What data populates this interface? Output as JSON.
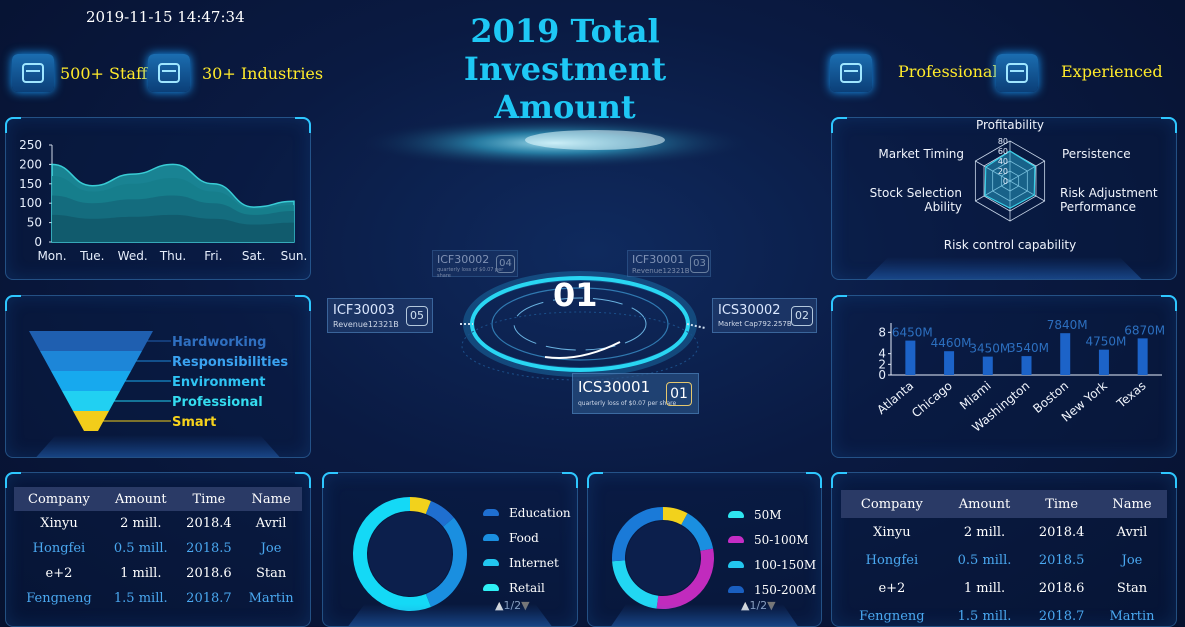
{
  "header": {
    "datetime": "2019-11-15 14:47:34",
    "title_line1": "2019 Total Investment",
    "title_line2": "Amount",
    "left_items": [
      {
        "label": "500+ Staff",
        "icon": "server-icon"
      },
      {
        "label": "30+ Industries",
        "icon": "server-icon"
      }
    ],
    "right_items": [
      {
        "label": "Professional",
        "icon": "server-icon"
      },
      {
        "label": "Experienced",
        "icon": "server-icon"
      }
    ]
  },
  "area_chart": {
    "type": "area",
    "x": [
      "Mon.",
      "Tue.",
      "Wed.",
      "Thu.",
      "Fri.",
      "Sat.",
      "Sun."
    ],
    "series": [
      {
        "values": [
          200,
          145,
          175,
          200,
          150,
          90,
          105
        ]
      },
      {
        "values": [
          170,
          130,
          150,
          165,
          130,
          85,
          95
        ]
      },
      {
        "values": [
          120,
          100,
          110,
          120,
          100,
          70,
          80
        ]
      },
      {
        "values": [
          70,
          60,
          65,
          70,
          60,
          45,
          50
        ]
      }
    ],
    "yticks": [
      "250",
      "200",
      "150",
      "100",
      "50",
      "0"
    ],
    "ylim": [
      0,
      250
    ]
  },
  "funnel": {
    "levels": [
      {
        "label": "Hardworking",
        "color": "#1f5fb0",
        "text_color": "#2f6fc0"
      },
      {
        "label": "Responsibilities",
        "color": "#1d86d8",
        "text_color": "#3aa2f0"
      },
      {
        "label": "Environment",
        "color": "#17a9ee",
        "text_color": "#2fc4f4"
      },
      {
        "label": "Professional",
        "color": "#21d0f2",
        "text_color": "#34dcef"
      },
      {
        "label": "Smart",
        "color": "#f2cd1a",
        "text_color": "#f6d21c"
      }
    ]
  },
  "center": {
    "big_number": "01",
    "chips": [
      {
        "title": "ICF30002",
        "sub": "quarterly loss of $0.07 per share",
        "num": "04"
      },
      {
        "title": "ICF30001",
        "sub": "Revenue12321B",
        "num": "03"
      },
      {
        "title": "ICF30003",
        "sub": "Revenue12321B",
        "num": "05"
      },
      {
        "title": "ICS30002",
        "sub": "Market Cap792.257B",
        "num": "02"
      },
      {
        "title": "ICS30001",
        "sub": "quarterly loss of $0.07 per share",
        "num": "01"
      }
    ]
  },
  "radar": {
    "indicators": [
      "Profitability",
      "Persistence",
      "Risk Adjustment\nPerformance",
      "Risk control capability",
      "Stock Selection\nAbility",
      "Market Timing"
    ],
    "scale": [
      "80",
      "60",
      "40",
      "20",
      "0"
    ],
    "values": [
      75,
      72,
      70,
      68,
      72,
      70
    ]
  },
  "bar_chart": {
    "type": "bar",
    "categories": [
      "Atlanta",
      "Chicago",
      "Miami",
      "Washington",
      "Boston",
      "New York",
      "Texas"
    ],
    "values": [
      6.45,
      4.46,
      3.45,
      3.54,
      7.84,
      4.75,
      6.87
    ],
    "data_labels": [
      "6450M",
      "4460M",
      "3450M",
      "3540M",
      "7840M",
      "4750M",
      "6870M"
    ],
    "yticks": [
      "8",
      "4",
      "2",
      "0"
    ],
    "ylim": [
      0,
      9
    ]
  },
  "table_left": {
    "headers": [
      "Company",
      "Amount",
      "Time",
      "Name"
    ],
    "rows": [
      [
        "Xinyu",
        "2 mill.",
        "2018.4",
        "Avril"
      ],
      [
        "Hongfei",
        "0.5 mill.",
        "2018.5",
        "Joe"
      ],
      [
        "e+2",
        "1 mill.",
        "2018.6",
        "Stan"
      ],
      [
        "Fengneng",
        "1.5 mill.",
        "2018.7",
        "Martin"
      ]
    ]
  },
  "table_right": {
    "headers": [
      "Company",
      "Amount",
      "Time",
      "Name"
    ],
    "rows": [
      [
        "Xinyu",
        "2 mill.",
        "2018.4",
        "Avril"
      ],
      [
        "Hongfei",
        "0.5 mill.",
        "2018.5",
        "Joe"
      ],
      [
        "e+2",
        "1 mill.",
        "2018.6",
        "Stan"
      ],
      [
        "Fengneng",
        "1.5 mill.",
        "2018.7",
        "Martin"
      ]
    ]
  },
  "donut1": {
    "type": "pie",
    "legend": [
      "Education",
      "Food",
      "Internet",
      "Retail"
    ],
    "colors": [
      "#1f6fd0",
      "#1a8fe0",
      "#22c6ef",
      "#2ef0f5"
    ],
    "slices": [
      {
        "value": 6,
        "color": "#f2d21c"
      },
      {
        "value": 8,
        "color": "#1f6fd0"
      },
      {
        "value": 30,
        "color": "#1a8fe0"
      },
      {
        "value": 56,
        "color": "#14d9f6"
      }
    ],
    "pager": "1/2"
  },
  "donut2": {
    "type": "pie",
    "legend": [
      "50M",
      "50-100M",
      "100-150M",
      "150-200M"
    ],
    "colors": [
      "#2ee6f0",
      "#c52dc5",
      "#22c6ef",
      "#1a5fc0"
    ],
    "slices": [
      {
        "value": 8,
        "color": "#f2d21c"
      },
      {
        "value": 14,
        "color": "#1a8fe0"
      },
      {
        "value": 30,
        "color": "#c12bbd"
      },
      {
        "value": 22,
        "color": "#22d6f2"
      },
      {
        "value": 26,
        "color": "#1a7ad8"
      }
    ],
    "pager": "1/2"
  }
}
